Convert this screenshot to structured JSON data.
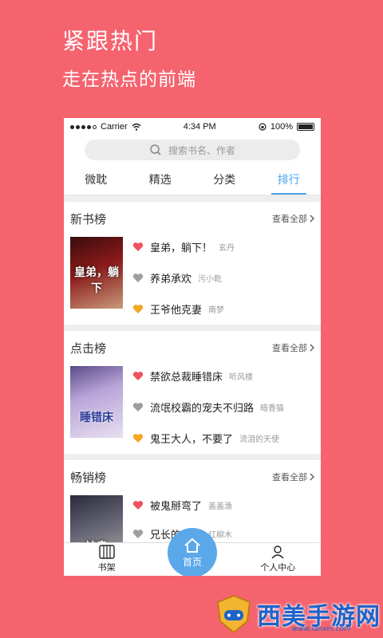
{
  "promo": {
    "title": "紧跟热门",
    "subtitle": "走在热点的前端"
  },
  "status": {
    "carrier": "Carrier",
    "time": "4:34 PM",
    "battery": "100%"
  },
  "search": {
    "placeholder": "搜索书名、作者"
  },
  "tabs": [
    {
      "label": "微耽",
      "active": false
    },
    {
      "label": "精选",
      "active": false
    },
    {
      "label": "分类",
      "active": false
    },
    {
      "label": "排行",
      "active": true
    }
  ],
  "colors": {
    "accent": "#4aa3ea",
    "background": "#f5636f",
    "heart_red": "#f0525e",
    "heart_gray": "#9e9e9e",
    "heart_orange": "#f5a623"
  },
  "sections": [
    {
      "title": "新书榜",
      "more": "查看全部",
      "cover_text": "皇弟，躺下",
      "items": [
        {
          "title": "皇弟，躺下！",
          "author": "玄丹",
          "heart": "red"
        },
        {
          "title": "养弟承欢",
          "author": "污小乾",
          "heart": "gray"
        },
        {
          "title": "王爷他克妻",
          "author": "南梦",
          "heart": "orange"
        }
      ]
    },
    {
      "title": "点击榜",
      "more": "查看全部",
      "cover_text": "睡错床",
      "items": [
        {
          "title": "禁欲总裁睡错床",
          "author": "听风楼",
          "heart": "red"
        },
        {
          "title": "流氓校霸的宠夫不归路",
          "author": "暗香猫",
          "heart": "gray"
        },
        {
          "title": "鬼王大人，不要了",
          "author": "流泪的天使",
          "heart": "orange"
        }
      ]
    },
    {
      "title": "畅销榜",
      "more": "查看全部",
      "cover_text": "被鬼",
      "items": [
        {
          "title": "被鬼掰弯了",
          "author": "盖盖渔",
          "heart": "red"
        },
        {
          "title": "兄长的侵控",
          "author": "红柳木",
          "heart": "gray"
        }
      ]
    }
  ],
  "tabbar": {
    "bookshelf": "书架",
    "home": "首页",
    "profile": "个人中心"
  },
  "watermark": {
    "text": "西美手游网",
    "url": "www.lanxin.com"
  }
}
